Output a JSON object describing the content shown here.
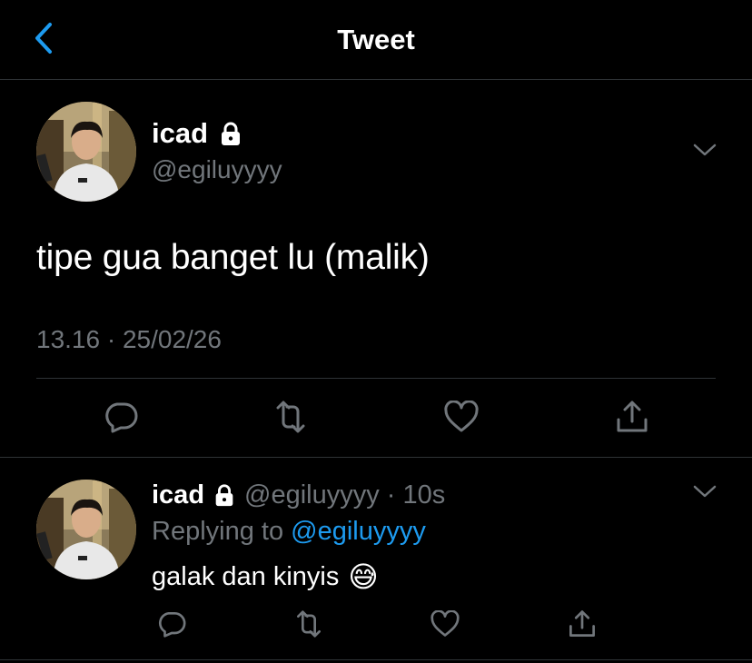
{
  "header": {
    "title": "Tweet",
    "back_icon": "chevron-left-icon"
  },
  "colors": {
    "background": "#000000",
    "accent": "#1d9bf0",
    "secondary_text": "#71767b",
    "divider": "#2f3336"
  },
  "main_tweet": {
    "name": "icad",
    "handle": "@egiluyyyy",
    "protected_icon": "lock-icon",
    "text": "tipe gua banget lu (malik)",
    "timestamp": "13.16 · 25/02/26",
    "actions": [
      "reply-icon",
      "retweet-icon",
      "like-icon",
      "share-icon"
    ]
  },
  "reply_tweet": {
    "name": "icad",
    "handle_time": "@egiluyyyy · 10s",
    "replying_prefix": "Replying to",
    "replying_to": "@egiluyyyy",
    "text": "galak dan kinyis",
    "emoji": "😅",
    "actions": [
      "reply-icon",
      "retweet-icon",
      "like-icon",
      "share-icon"
    ]
  }
}
